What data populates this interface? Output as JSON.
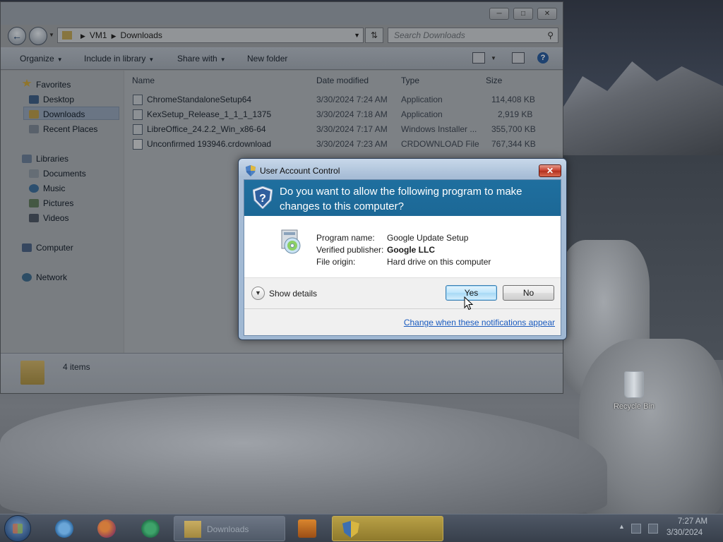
{
  "explorer": {
    "address": {
      "segments": [
        "VM1",
        "Downloads"
      ]
    },
    "search_placeholder": "Search Downloads",
    "toolbar": {
      "organize": "Organize",
      "include_in_library": "Include in library",
      "share_with": "Share with",
      "new_folder": "New folder"
    },
    "nav": {
      "favorites": "Favorites",
      "desktop": "Desktop",
      "downloads": "Downloads",
      "recent_places": "Recent Places",
      "libraries": "Libraries",
      "documents": "Documents",
      "music": "Music",
      "pictures": "Pictures",
      "videos": "Videos",
      "computer": "Computer",
      "network": "Network"
    },
    "columns": {
      "name": "Name",
      "date_modified": "Date modified",
      "type": "Type",
      "size": "Size"
    },
    "files": [
      {
        "name": "ChromeStandaloneSetup64",
        "date": "3/30/2024 7:24 AM",
        "type": "Application",
        "size": "114,408 KB"
      },
      {
        "name": "KexSetup_Release_1_1_1_1375",
        "date": "3/30/2024 7:18 AM",
        "type": "Application",
        "size": "2,919 KB"
      },
      {
        "name": "LibreOffice_24.2.2_Win_x86-64",
        "date": "3/30/2024 7:17 AM",
        "type": "Windows Installer ...",
        "size": "355,700 KB"
      },
      {
        "name": "Unconfirmed 193946.crdownload",
        "date": "3/30/2024 7:23 AM",
        "type": "CRDOWNLOAD File",
        "size": "767,344 KB"
      }
    ],
    "status": "4 items"
  },
  "uac": {
    "title": "User Account Control",
    "question": "Do you want to allow the following program to make changes to this computer?",
    "program_name_label": "Program name:",
    "program_name": "Google Update Setup",
    "publisher_label": "Verified publisher:",
    "publisher": "Google LLC",
    "origin_label": "File origin:",
    "origin": "Hard drive on this computer",
    "show_details": "Show details",
    "yes": "Yes",
    "no": "No",
    "notifications_link": "Change when these notifications appear",
    "colors": {
      "banner": "#1f6f9f",
      "link": "#1a5bbf"
    }
  },
  "desktop": {
    "recycle_bin": "Recycle Bin"
  },
  "taskbar": {
    "downloads_task": "Downloads",
    "time": "7:27 AM",
    "date": "3/30/2024"
  }
}
